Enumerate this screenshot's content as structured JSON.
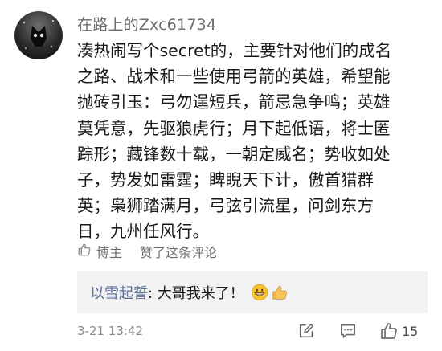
{
  "comment": {
    "username": "在路上的Zxc61734",
    "lines": [
      "凑热闹写个secret的，主要针对他们的成名",
      "之路、战术和一些使用弓箭的英雄，希望能",
      "抛砖引玉：弓勿逞短兵，箭忌急争鸣；英雄",
      "莫凭意，先驱狼虎行；月下起低语，将士匿",
      "踪形；藏锋数十载，一朝定威名；势收如处",
      "子，势发如雷霆；睥睨天下计，傲首猎群",
      "英；枭狮踏满月，弓弦引流星，问剑东方",
      "日，九州任风行。"
    ],
    "liked_by": "博主",
    "liked_label": "赞了这条评论",
    "timestamp": "3-21 13:42",
    "like_count": "15"
  },
  "reply": {
    "name": "以雪起誓",
    "text": ": 大哥我来了！"
  },
  "icons": {
    "liked": "thumbs-up-icon",
    "reply_emoji_1": "grinning-face-icon",
    "reply_emoji_2": "thumbs-up-emoji-icon",
    "forward": "edit-forward-icon",
    "comment": "comment-icon",
    "like": "like-icon"
  }
}
